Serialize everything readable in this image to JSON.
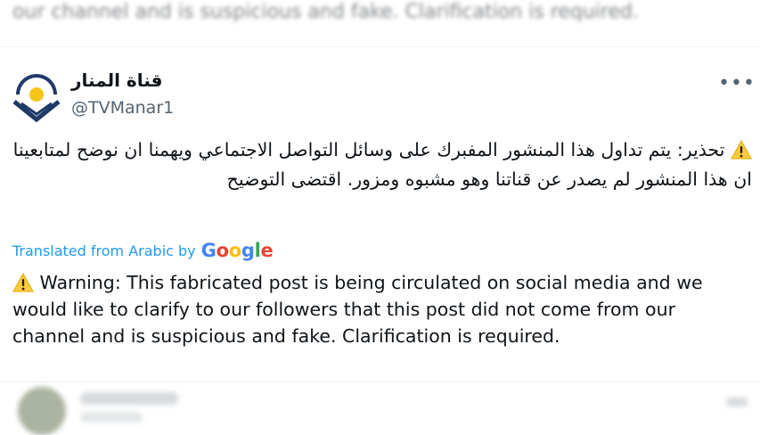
{
  "previous_tweet": {
    "text": "our channel and is suspicious and fake. Clarification is required."
  },
  "tweet": {
    "display_name": "قناة المنار",
    "handle": "@TVManar1",
    "more_label": "•••",
    "text_arabic": "تحذير: يتم تداول هذا المنشور المفبرك على وسائل التواصل الاجتماعي ويهمنا ان نوضح لمتابعينا ان هذا المنشور لم يصدر عن  قناتنا وهو مشبوه ومزور. اقتضى التوضيح",
    "translated_label": "Translated from Arabic by",
    "translator": "Google",
    "text_english": "Warning: This fabricated post is being circulated on social media and we would like to clarify to our followers that this post did not come from our channel and is suspicious and fake. Clarification is required."
  },
  "colors": {
    "link_blue": "#1d9bf0",
    "avatar_navy": "#1f3a68",
    "avatar_yellow": "#f5c518",
    "warning_yellow": "#ffcc3e"
  },
  "icons": [
    "warning-icon",
    "more-options-icon",
    "al-manar-logo"
  ]
}
